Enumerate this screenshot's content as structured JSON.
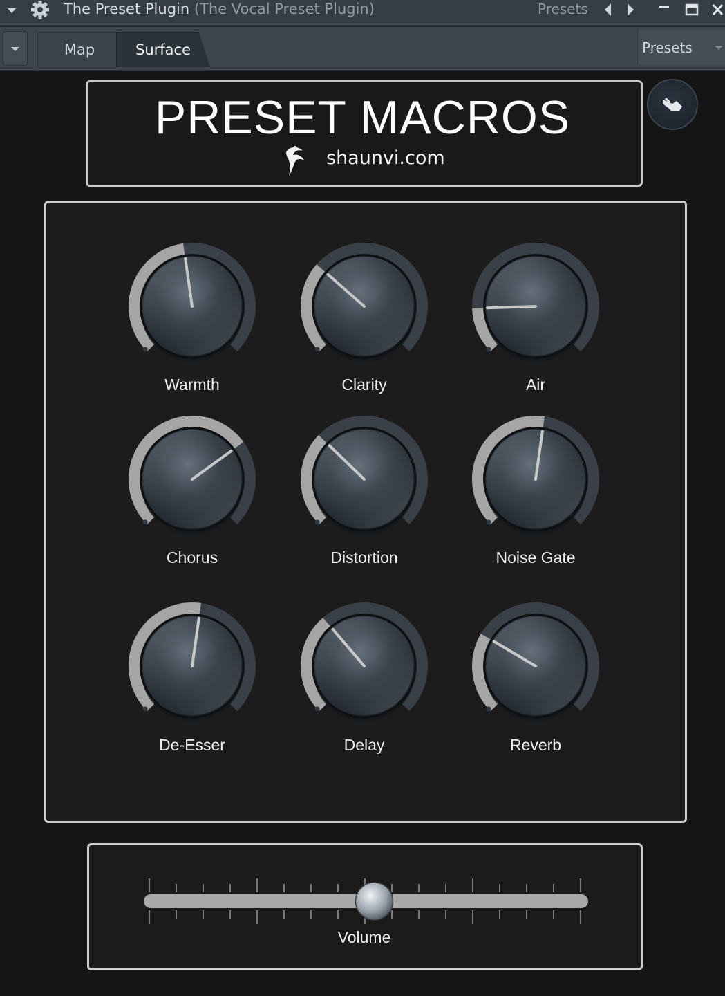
{
  "titlebar": {
    "title": "The Preset Plugin",
    "subtitle": "(The Vocal Preset Plugin)",
    "presets_label": "Presets"
  },
  "tabs": [
    {
      "label": "Map",
      "active": false
    },
    {
      "label": "Surface",
      "active": true
    }
  ],
  "presets_button": "Presets",
  "header": {
    "title": "PRESET MACROS",
    "url": "shaunvi.com"
  },
  "macros": [
    {
      "label": "Warmth",
      "value": 0.47
    },
    {
      "label": "Clarity",
      "value": 0.32
    },
    {
      "label": "Air",
      "value": 0.16
    },
    {
      "label": "Chorus",
      "value": 0.7
    },
    {
      "label": "Distortion",
      "value": 0.33
    },
    {
      "label": "Noise Gate",
      "value": 0.53
    },
    {
      "label": "De-Esser",
      "value": 0.53
    },
    {
      "label": "Delay",
      "value": 0.35
    },
    {
      "label": "Reverb",
      "value": 0.28
    }
  ],
  "volume": {
    "label": "Volume",
    "value": 0.5
  },
  "colors": {
    "titlebar": "#353d45",
    "tabbar": "#3d464e",
    "panel_border": "#cfcfcf",
    "knob_arc": "#a8a8a8"
  }
}
